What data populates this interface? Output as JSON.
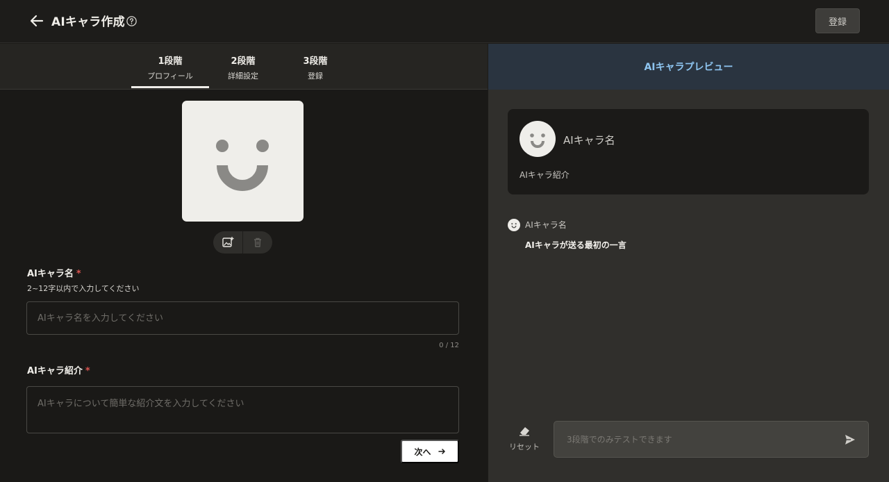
{
  "header": {
    "title": "AIキャラ作成",
    "register_label": "登録"
  },
  "steps": [
    {
      "num": "1段階",
      "label": "プロフィール",
      "active": true
    },
    {
      "num": "2段階",
      "label": "詳細設定",
      "active": false
    },
    {
      "num": "3段階",
      "label": "登録",
      "active": false
    }
  ],
  "form": {
    "name": {
      "label": "AIキャラ名",
      "required_mark": "*",
      "hint": "2~12字以内で入力してください",
      "placeholder": "AIキャラ名を入力してください",
      "value": "",
      "counter": "0 / 12"
    },
    "intro": {
      "label": "AIキャラ紹介",
      "required_mark": "*",
      "placeholder": "AIキャラについて簡単な紹介文を入力してください",
      "value": ""
    },
    "next_label": "次へ"
  },
  "preview": {
    "header": "AIキャラプレビュー",
    "card_name": "AIキャラ名",
    "card_intro": "AIキャラ紹介",
    "chat_name": "AIキャラ名",
    "chat_message": "AIキャラが送る最初の一言",
    "reset_label": "リセット",
    "input_placeholder": "3段階でのみテストできます"
  },
  "colors": {
    "accent_blue": "#8ec5f0",
    "required_red": "#d9534f",
    "avatar_bg": "#efeeea",
    "face": "#8a8986"
  },
  "icons": {
    "back": "back-arrow-icon",
    "help": "help-icon",
    "add_image": "add-image-icon",
    "delete": "trash-icon",
    "reset": "eraser-icon",
    "send": "send-icon",
    "next": "arrow-right-icon"
  }
}
